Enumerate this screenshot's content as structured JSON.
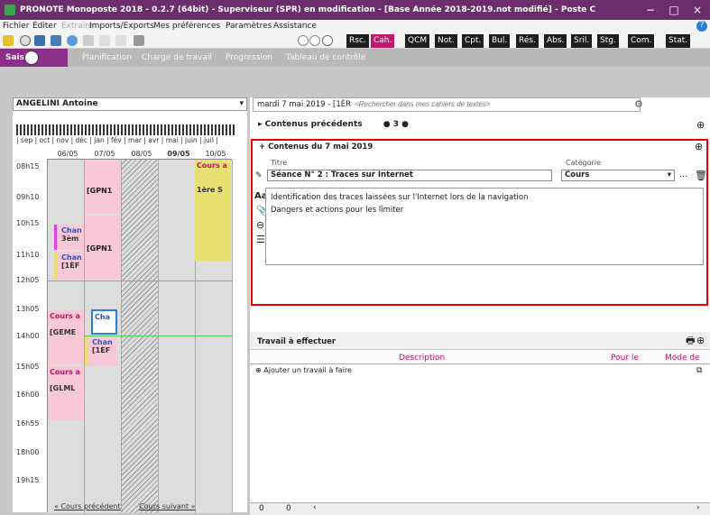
{
  "window": {
    "title": "PRONOTE Monoposte 2018 - 0.2.7 (64bit) - Superviseur (SPR) en modification - [Base Année 2018-2019.not modifié] - Poste C",
    "minimize": "−",
    "maximize": "□",
    "close": "×"
  },
  "menu": [
    "Fichier",
    "Éditer",
    "Extraire",
    "Imports/Exports",
    "Mes préférences",
    "Paramètres",
    "Assistance"
  ],
  "tools": [
    "Rsc.",
    "Cah.",
    "QCM",
    "Not.",
    "Cpt.",
    "Bul.",
    "Rés.",
    "Abs.",
    "Sril.",
    "Stg.",
    "Com.",
    "Stat."
  ],
  "tabs": {
    "saisie": "Saisie",
    "planification": "Planification",
    "charge": "Charge de travail",
    "progression": "Progression",
    "tableau": "Tableau de contrôle"
  },
  "left": {
    "selector": "ANGELINI Antoine",
    "months": "| sep | oct | nov | déc | jan | fév | mar | avr | mai | juin | juil |",
    "days": [
      "06/05",
      "07/05",
      "08/05",
      "09/05",
      "10/05"
    ],
    "hours": [
      "08h15",
      "09h10",
      "10h15",
      "11h10",
      "12h05",
      "13h05",
      "14h00",
      "15h05",
      "16h00",
      "16h55",
      "18h00",
      "19h15"
    ],
    "courses": [
      "Cours a",
      "1ère S",
      "[GPN1",
      "[GPN1",
      "Chan",
      "3èm",
      "Chan",
      "[1ÈF",
      "Cours a",
      "[GEME",
      "Cha",
      "Chan",
      "[1ÈF",
      "Cours a",
      "[GLML"
    ],
    "prev": "« Cours précédent",
    "next": "Cours suivant »"
  },
  "right": {
    "date": "mardi 7 mai 2019 - [1ÈR",
    "search_placeholder": "<Rechercher dans mes cahiers de textes>",
    "prev_contents": "Contenus précédents",
    "prev_count": "3",
    "contenus_title": "Contenus du 7 mai 2019",
    "titre_label": "Titre",
    "categorie_label": "Catégorie",
    "seance": "Séance N° 2 : Traces sur Internet",
    "categorie": "Cours",
    "lines": [
      "Identification des traces laissées sur l'Internet lors de la navigation",
      "Dangers et actions pour les limiter"
    ],
    "travail_title": "Travail à effectuer",
    "col_desc": "Description",
    "col_pour": "Pour le",
    "col_mode": "Mode de",
    "add_travail": "Ajouter un travail à faire",
    "bottom_nums": [
      "0",
      "0"
    ]
  },
  "colors": {
    "title": "#6b2d6b",
    "saisie": "#8b2f8b",
    "cah": "#c0186a",
    "tool": "#1e1e1e",
    "red": "#e00000",
    "pink": "#f8c8d8",
    "yellow": "#e8e070"
  }
}
